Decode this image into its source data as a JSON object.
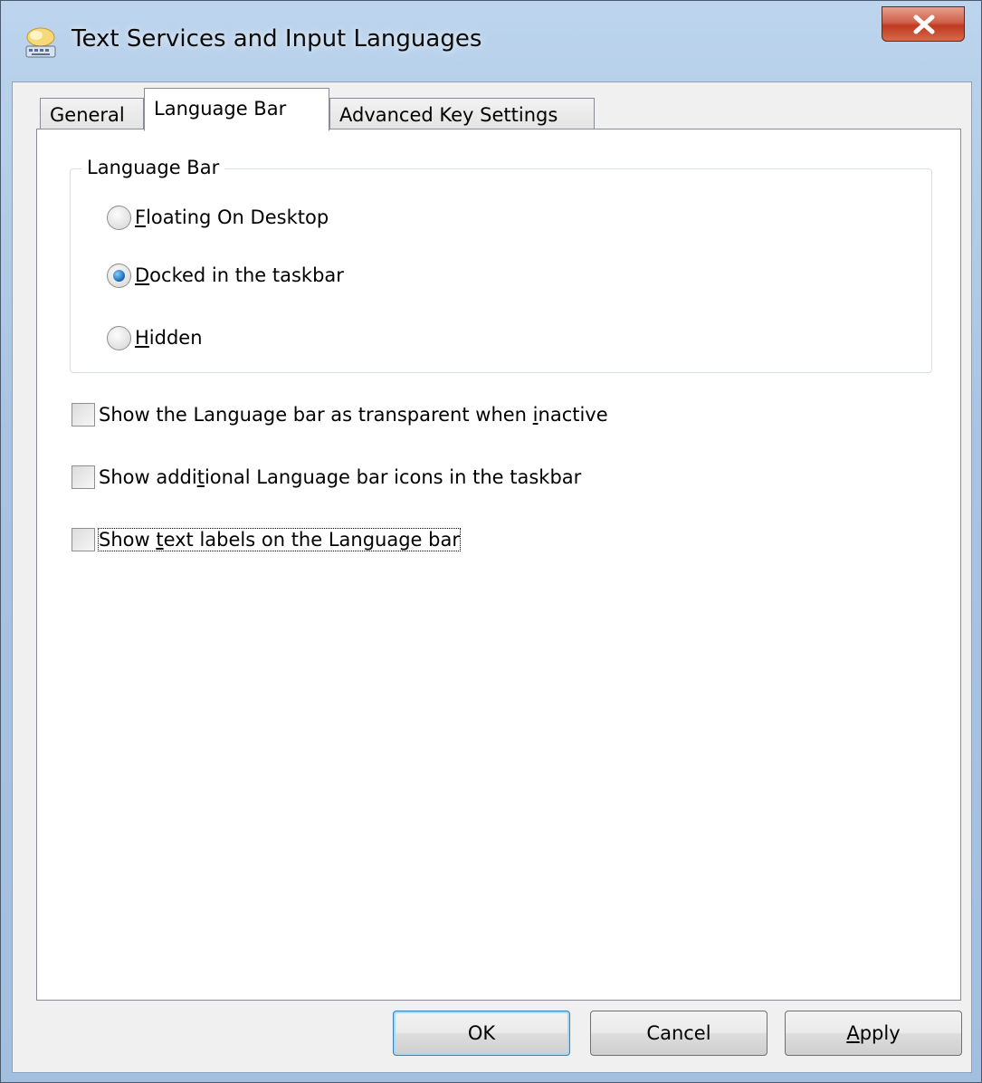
{
  "window": {
    "title": "Text Services and Input Languages",
    "icon": "keyboard-cloud-icon",
    "close_icon": "close-x-icon"
  },
  "tabs": [
    {
      "label": "General",
      "active": false
    },
    {
      "label": "Language Bar",
      "active": true
    },
    {
      "label": "Advanced Key Settings",
      "active": false
    }
  ],
  "language_bar_group": {
    "title": "Language Bar",
    "options": [
      {
        "mnemonic": "F",
        "rest": "loating On Desktop",
        "checked": false
      },
      {
        "mnemonic": "D",
        "rest": "ocked in the taskbar",
        "checked": true
      },
      {
        "mnemonic": "H",
        "rest": "idden",
        "checked": false
      }
    ]
  },
  "checkboxes": [
    {
      "before": "Show the Language bar as transparent when ",
      "mnemonic": "i",
      "after": "nactive",
      "checked": false
    },
    {
      "before": "Show addi",
      "mnemonic": "t",
      "after": "ional Language bar icons in the taskbar",
      "checked": false
    },
    {
      "before": "Show ",
      "mnemonic": "t",
      "after": "ext labels on the Language bar",
      "checked": false
    }
  ],
  "buttons": {
    "ok": "OK",
    "cancel": "Cancel",
    "apply_mnemonic": "A",
    "apply_rest": "pply"
  },
  "colors": {
    "accent": "#3c7fb1",
    "close_red": "#c7432a"
  }
}
